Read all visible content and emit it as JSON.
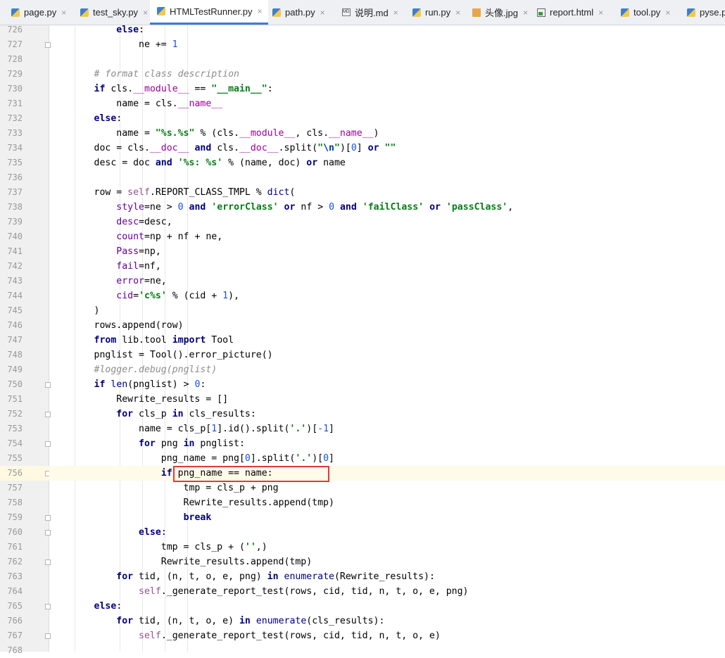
{
  "tabs": [
    {
      "label": "page.py",
      "icon": "python-file-icon",
      "active": false
    },
    {
      "label": "test_sky.py",
      "icon": "python-file-icon",
      "active": false
    },
    {
      "label": "HTMLTestRunner.py",
      "icon": "python-file-icon",
      "active": true
    },
    {
      "label": "path.py",
      "icon": "python-file-icon",
      "active": false
    },
    {
      "label": "说明.md",
      "icon": "markdown-file-icon",
      "active": false
    },
    {
      "label": "run.py",
      "icon": "python-file-icon",
      "active": false
    },
    {
      "label": "头像.jpg",
      "icon": "image-file-icon",
      "active": false
    },
    {
      "label": "report.html",
      "icon": "html-file-icon",
      "active": false
    },
    {
      "label": "tool.py",
      "icon": "python-file-icon",
      "active": false
    },
    {
      "label": "pyse.py",
      "icon": "python-file-icon",
      "active": false
    }
  ],
  "close_glyph": "×",
  "current_line": "756",
  "lines": [
    {
      "n": "726",
      "t": [
        [
          "            ",
          ""
        ],
        [
          "else",
          "kw"
        ],
        [
          ":",
          ""
        ]
      ]
    },
    {
      "n": "727",
      "t": [
        [
          "                ne += ",
          ""
        ],
        [
          "1",
          "num"
        ]
      ]
    },
    {
      "n": "728",
      "t": []
    },
    {
      "n": "729",
      "t": [
        [
          "        ",
          ""
        ],
        [
          "# format class description",
          "cm"
        ]
      ]
    },
    {
      "n": "730",
      "t": [
        [
          "        ",
          ""
        ],
        [
          "if",
          "kw"
        ],
        [
          " cls.",
          ""
        ],
        [
          "__module__",
          "dun"
        ],
        [
          " == ",
          ""
        ],
        [
          "\"__main__\"",
          "str"
        ],
        [
          ":",
          ""
        ]
      ]
    },
    {
      "n": "731",
      "t": [
        [
          "            name = cls.",
          ""
        ],
        [
          "__name__",
          "dun"
        ]
      ]
    },
    {
      "n": "732",
      "t": [
        [
          "        ",
          ""
        ],
        [
          "else",
          "kw"
        ],
        [
          ":",
          ""
        ]
      ]
    },
    {
      "n": "733",
      "t": [
        [
          "            name = ",
          ""
        ],
        [
          "\"%s.%s\"",
          "str"
        ],
        [
          " % (cls.",
          ""
        ],
        [
          "__module__",
          "dun"
        ],
        [
          ", cls.",
          ""
        ],
        [
          "__name__",
          "dun"
        ],
        [
          ")",
          ""
        ]
      ]
    },
    {
      "n": "734",
      "t": [
        [
          "        doc = cls.",
          ""
        ],
        [
          "__doc__",
          "dun"
        ],
        [
          " ",
          ""
        ],
        [
          "and",
          "kw"
        ],
        [
          " cls.",
          ""
        ],
        [
          "__doc__",
          "dun"
        ],
        [
          ".split(",
          ""
        ],
        [
          "\"",
          "str"
        ],
        [
          "\\n",
          "esc"
        ],
        [
          "\"",
          "str"
        ],
        [
          ")[",
          ""
        ],
        [
          "0",
          "num"
        ],
        [
          "] ",
          ""
        ],
        [
          "or",
          "kw"
        ],
        [
          " ",
          ""
        ],
        [
          "\"\"",
          "str"
        ]
      ]
    },
    {
      "n": "735",
      "t": [
        [
          "        desc = doc ",
          ""
        ],
        [
          "and",
          "kw"
        ],
        [
          " ",
          ""
        ],
        [
          "'%s: %s'",
          "str"
        ],
        [
          " % (name, doc) ",
          ""
        ],
        [
          "or",
          "kw"
        ],
        [
          " name",
          ""
        ]
      ]
    },
    {
      "n": "736",
      "t": []
    },
    {
      "n": "737",
      "t": [
        [
          "        row = ",
          ""
        ],
        [
          "self",
          "slf"
        ],
        [
          ".REPORT_CLASS_TMPL % ",
          ""
        ],
        [
          "dict",
          "bi"
        ],
        [
          "(",
          ""
        ]
      ]
    },
    {
      "n": "738",
      "t": [
        [
          "            ",
          ""
        ],
        [
          "style",
          "kwa"
        ],
        [
          "=ne > ",
          ""
        ],
        [
          "0",
          "num"
        ],
        [
          " ",
          ""
        ],
        [
          "and",
          "kw"
        ],
        [
          " ",
          ""
        ],
        [
          "'errorClass'",
          "str"
        ],
        [
          " ",
          ""
        ],
        [
          "or",
          "kw"
        ],
        [
          " nf > ",
          ""
        ],
        [
          "0",
          "num"
        ],
        [
          " ",
          ""
        ],
        [
          "and",
          "kw"
        ],
        [
          " ",
          ""
        ],
        [
          "'failClass'",
          "str"
        ],
        [
          " ",
          ""
        ],
        [
          "or",
          "kw"
        ],
        [
          " ",
          ""
        ],
        [
          "'passClass'",
          "str"
        ],
        [
          ",",
          ""
        ]
      ]
    },
    {
      "n": "739",
      "t": [
        [
          "            ",
          ""
        ],
        [
          "desc",
          "kwa"
        ],
        [
          "=desc,",
          ""
        ]
      ]
    },
    {
      "n": "740",
      "t": [
        [
          "            ",
          ""
        ],
        [
          "count",
          "kwa"
        ],
        [
          "=np + nf + ne,",
          ""
        ]
      ]
    },
    {
      "n": "741",
      "t": [
        [
          "            ",
          ""
        ],
        [
          "Pass",
          "kwa"
        ],
        [
          "=np,",
          ""
        ]
      ]
    },
    {
      "n": "742",
      "t": [
        [
          "            ",
          ""
        ],
        [
          "fail",
          "kwa"
        ],
        [
          "=nf,",
          ""
        ]
      ]
    },
    {
      "n": "743",
      "t": [
        [
          "            ",
          ""
        ],
        [
          "error",
          "kwa"
        ],
        [
          "=ne,",
          ""
        ]
      ]
    },
    {
      "n": "744",
      "t": [
        [
          "            ",
          ""
        ],
        [
          "cid",
          "kwa"
        ],
        [
          "=",
          ""
        ],
        [
          "'c%s'",
          "str"
        ],
        [
          " % (cid + ",
          ""
        ],
        [
          "1",
          "num"
        ],
        [
          "),",
          ""
        ]
      ]
    },
    {
      "n": "745",
      "t": [
        [
          "        )",
          ""
        ]
      ]
    },
    {
      "n": "746",
      "t": [
        [
          "        rows.append(row)",
          ""
        ]
      ]
    },
    {
      "n": "747",
      "t": [
        [
          "        ",
          ""
        ],
        [
          "from",
          "kw"
        ],
        [
          " lib.tool ",
          ""
        ],
        [
          "import",
          "kw"
        ],
        [
          " Tool",
          ""
        ]
      ]
    },
    {
      "n": "748",
      "t": [
        [
          "        pnglist = Tool().error_picture()",
          ""
        ]
      ]
    },
    {
      "n": "749",
      "t": [
        [
          "        ",
          ""
        ],
        [
          "#logger.debug(pnglist)",
          "cm"
        ]
      ]
    },
    {
      "n": "750",
      "t": [
        [
          "        ",
          ""
        ],
        [
          "if",
          "kw"
        ],
        [
          " ",
          ""
        ],
        [
          "len",
          "bi"
        ],
        [
          "(pnglist) > ",
          ""
        ],
        [
          "0",
          "num"
        ],
        [
          ":",
          ""
        ]
      ]
    },
    {
      "n": "751",
      "t": [
        [
          "            Rewrite_results = []",
          ""
        ]
      ]
    },
    {
      "n": "752",
      "t": [
        [
          "            ",
          ""
        ],
        [
          "for",
          "kw"
        ],
        [
          " cls_p ",
          ""
        ],
        [
          "in",
          "kw"
        ],
        [
          " cls_results:",
          ""
        ]
      ]
    },
    {
      "n": "753",
      "t": [
        [
          "                name = cls_p[",
          ""
        ],
        [
          "1",
          "num"
        ],
        [
          "].id().split(",
          ""
        ],
        [
          "'.'",
          "str"
        ],
        [
          ")[",
          ""
        ],
        [
          "-1",
          "num"
        ],
        [
          "]",
          ""
        ]
      ]
    },
    {
      "n": "754",
      "t": [
        [
          "                ",
          ""
        ],
        [
          "for",
          "kw"
        ],
        [
          " png ",
          ""
        ],
        [
          "in",
          "kw"
        ],
        [
          " pnglist:",
          ""
        ]
      ]
    },
    {
      "n": "755",
      "t": [
        [
          "                    png_name = png[",
          ""
        ],
        [
          "0",
          "num"
        ],
        [
          "].split(",
          ""
        ],
        [
          "'.'",
          "str"
        ],
        [
          ")[",
          ""
        ],
        [
          "0",
          "num"
        ],
        [
          "]",
          ""
        ]
      ]
    },
    {
      "n": "756",
      "t": [
        [
          "                    ",
          ""
        ],
        [
          "if",
          "kw"
        ],
        [
          " png_name == name:",
          ""
        ]
      ]
    },
    {
      "n": "757",
      "t": [
        [
          "                        tmp = cls_p + png",
          ""
        ]
      ]
    },
    {
      "n": "758",
      "t": [
        [
          "                        Rewrite_results.append(tmp)",
          ""
        ]
      ]
    },
    {
      "n": "759",
      "t": [
        [
          "                        ",
          ""
        ],
        [
          "break",
          "kw"
        ]
      ]
    },
    {
      "n": "760",
      "t": [
        [
          "                ",
          ""
        ],
        [
          "else",
          "kw"
        ],
        [
          ":",
          ""
        ]
      ]
    },
    {
      "n": "761",
      "t": [
        [
          "                    tmp = cls_p + (",
          ""
        ],
        [
          "''",
          "str"
        ],
        [
          ",)",
          ""
        ]
      ]
    },
    {
      "n": "762",
      "t": [
        [
          "                    Rewrite_results.append(tmp)",
          ""
        ]
      ]
    },
    {
      "n": "763",
      "t": [
        [
          "            ",
          ""
        ],
        [
          "for",
          "kw"
        ],
        [
          " tid, (n, t, o, e, png) ",
          ""
        ],
        [
          "in",
          "kw"
        ],
        [
          " ",
          ""
        ],
        [
          "enumerate",
          "bi"
        ],
        [
          "(Rewrite_results):",
          ""
        ]
      ]
    },
    {
      "n": "764",
      "t": [
        [
          "                ",
          ""
        ],
        [
          "self",
          "slf"
        ],
        [
          "._generate_report_test(rows, cid, tid, n, t, o, e, png)",
          ""
        ]
      ]
    },
    {
      "n": "765",
      "t": [
        [
          "        ",
          ""
        ],
        [
          "else",
          "kw"
        ],
        [
          ":",
          ""
        ]
      ]
    },
    {
      "n": "766",
      "t": [
        [
          "            ",
          ""
        ],
        [
          "for",
          "kw"
        ],
        [
          " tid, (n, t, o, e) ",
          ""
        ],
        [
          "in",
          "kw"
        ],
        [
          " ",
          ""
        ],
        [
          "enumerate",
          "bi"
        ],
        [
          "(cls_results):",
          ""
        ]
      ]
    },
    {
      "n": "767",
      "t": [
        [
          "                ",
          ""
        ],
        [
          "self",
          "slf"
        ],
        [
          "._generate_report_test(rows, cid, tid, n, t, o, e)",
          ""
        ]
      ]
    },
    {
      "n": "768",
      "t": []
    }
  ],
  "fold_markers": [
    "727",
    "750",
    "752",
    "754",
    "756",
    "759",
    "760",
    "762",
    "765",
    "767"
  ]
}
